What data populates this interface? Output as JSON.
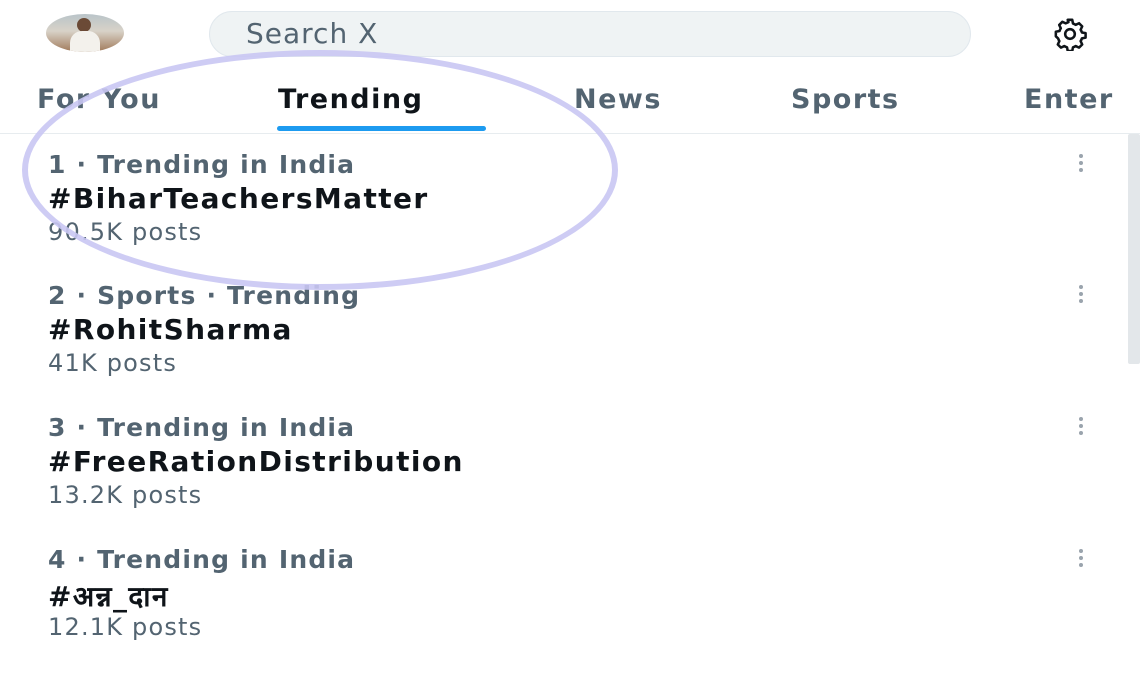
{
  "search": {
    "placeholder": "Search X"
  },
  "tabs": [
    {
      "label": "For You"
    },
    {
      "label": "Trending"
    },
    {
      "label": "News"
    },
    {
      "label": "Sports"
    },
    {
      "label": "Enter"
    }
  ],
  "trends": [
    {
      "context": "1 · Trending in India",
      "name": "#BiharTeachersMatter",
      "count": "90.5K posts"
    },
    {
      "context": "2 · Sports · Trending",
      "name": "#RohitSharma",
      "count": "41K posts"
    },
    {
      "context": "3 · Trending in India",
      "name": "#FreeRationDistribution",
      "count": "13.2K posts"
    },
    {
      "context": "4 · Trending in India",
      "name": "#अन्न_दान",
      "count": "12.1K posts"
    }
  ],
  "icons": {
    "settings": "gear-icon",
    "more": "more-vertical-icon"
  },
  "colors": {
    "accent": "#1d9bf0",
    "secondary_text": "#536471",
    "annotation": "#c9c6f3"
  }
}
